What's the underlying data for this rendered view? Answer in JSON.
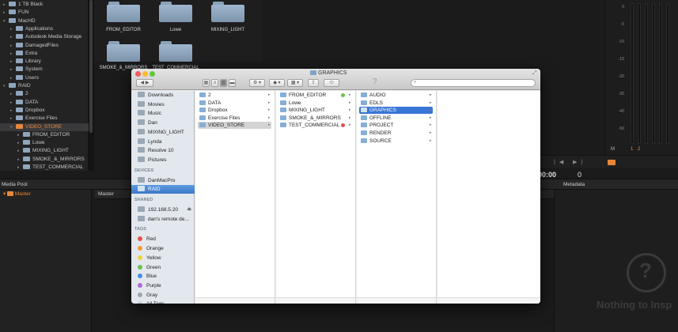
{
  "storage_tree": [
    {
      "label": "1 TB Black",
      "expanded": false
    },
    {
      "label": "FUN",
      "expanded": false
    },
    {
      "label": "MacHD",
      "expanded": true
    },
    {
      "label": "Applications",
      "expanded": false
    },
    {
      "label": "Autodesk Media Storage",
      "expanded": false
    },
    {
      "label": "DamagedFiles",
      "expanded": false
    },
    {
      "label": "Extra",
      "expanded": false
    },
    {
      "label": "Library",
      "expanded": false
    },
    {
      "label": "System",
      "expanded": false
    },
    {
      "label": "Users",
      "expanded": false
    },
    {
      "label": "RAID",
      "expanded": true
    },
    {
      "label": "2",
      "expanded": false
    },
    {
      "label": "DATA",
      "expanded": false
    },
    {
      "label": "Dropbox",
      "expanded": false
    },
    {
      "label": "Exercise Files",
      "expanded": false
    },
    {
      "label": "VIDEO_STORE",
      "expanded": true,
      "selected": true
    },
    {
      "label": "FROM_EDITOR",
      "expanded": false
    },
    {
      "label": "Lowe",
      "expanded": false
    },
    {
      "label": "MIXING_LIGHT",
      "expanded": false
    },
    {
      "label": "SMOKE_&_MIRRORS",
      "expanded": false
    },
    {
      "label": "TEST_COMMERCIAL",
      "expanded": false
    }
  ],
  "bin_folders": [
    {
      "label": "FROM_EDITOR"
    },
    {
      "label": "Lowe"
    },
    {
      "label": "MIXING_LIGHT"
    },
    {
      "label": "SMOKE_&_MIRRORS"
    },
    {
      "label": "TEST_COMMERCIAL"
    }
  ],
  "meter": {
    "ticks": [
      "0",
      "-5",
      "-10",
      "-15",
      "-20",
      "-30",
      "-40",
      "-50"
    ],
    "m_label": "M",
    "ch1": "1",
    "ch2": "2",
    "accent": "#e7873a"
  },
  "timecode": "00:00",
  "timecode_right": "0",
  "media_pool": {
    "title": "Media Pool",
    "master_row": "Master",
    "master_header": "Master",
    "metadata_title": "Metadata",
    "empty_text": "Nothing to Insp",
    "empty_icon": "question-magnifier-icon"
  },
  "finder": {
    "title": "GRAPHICS",
    "sidebar": {
      "favorites": [
        {
          "label": "Downloads",
          "icon": "downloads-icon"
        },
        {
          "label": "Movies",
          "icon": "movies-icon"
        },
        {
          "label": "Music",
          "icon": "music-icon"
        },
        {
          "label": "Dan",
          "icon": "home-icon"
        },
        {
          "label": "MIXING_LIGHT",
          "icon": "folder-icon"
        },
        {
          "label": "Lynda",
          "icon": "folder-icon"
        },
        {
          "label": "Resolve 10",
          "icon": "folder-icon"
        },
        {
          "label": "Pictures",
          "icon": "pictures-icon"
        }
      ],
      "devices_header": "DEVICES",
      "devices": [
        {
          "label": "DanMacPro",
          "icon": "computer-icon"
        },
        {
          "label": "RAID",
          "icon": "drive-icon",
          "selected": true
        }
      ],
      "shared_header": "SHARED",
      "shared": [
        {
          "label": "192.168.5.20",
          "icon": "server-icon",
          "eject": true
        },
        {
          "label": "dan's remote de...",
          "icon": "display-icon"
        }
      ],
      "tags_header": "TAGS",
      "tags": [
        {
          "label": "Red",
          "color": "#e5504a"
        },
        {
          "label": "Orange",
          "color": "#f29a38"
        },
        {
          "label": "Yellow",
          "color": "#efd13c"
        },
        {
          "label": "Green",
          "color": "#69c24f"
        },
        {
          "label": "Blue",
          "color": "#4a8fe3"
        },
        {
          "label": "Purple",
          "color": "#b16ad6"
        },
        {
          "label": "Gray",
          "color": "#a3a3a3"
        },
        {
          "label": "All Tags...",
          "color": "#d0d0d0"
        }
      ]
    },
    "column1": [
      {
        "label": "2"
      },
      {
        "label": "DATA"
      },
      {
        "label": "Dropbox"
      },
      {
        "label": "Exercise Files"
      },
      {
        "label": "VIDEO_STORE",
        "selected": true
      }
    ],
    "column2": [
      {
        "label": "FROM_EDITOR",
        "tag": "#69c24f"
      },
      {
        "label": "Lowe"
      },
      {
        "label": "MIXING_LIGHT"
      },
      {
        "label": "SMOKE_&_MIRRORS"
      },
      {
        "label": "TEST_COMMERCIAL",
        "tag": "#e5504a"
      }
    ],
    "column3": [
      {
        "label": "AUDIO"
      },
      {
        "label": "EDLS"
      },
      {
        "label": "GRAPHICS",
        "selected": true
      },
      {
        "label": "OFFLINE"
      },
      {
        "label": "PROJECT"
      },
      {
        "label": "RENDER"
      },
      {
        "label": "SOURCE"
      }
    ]
  }
}
